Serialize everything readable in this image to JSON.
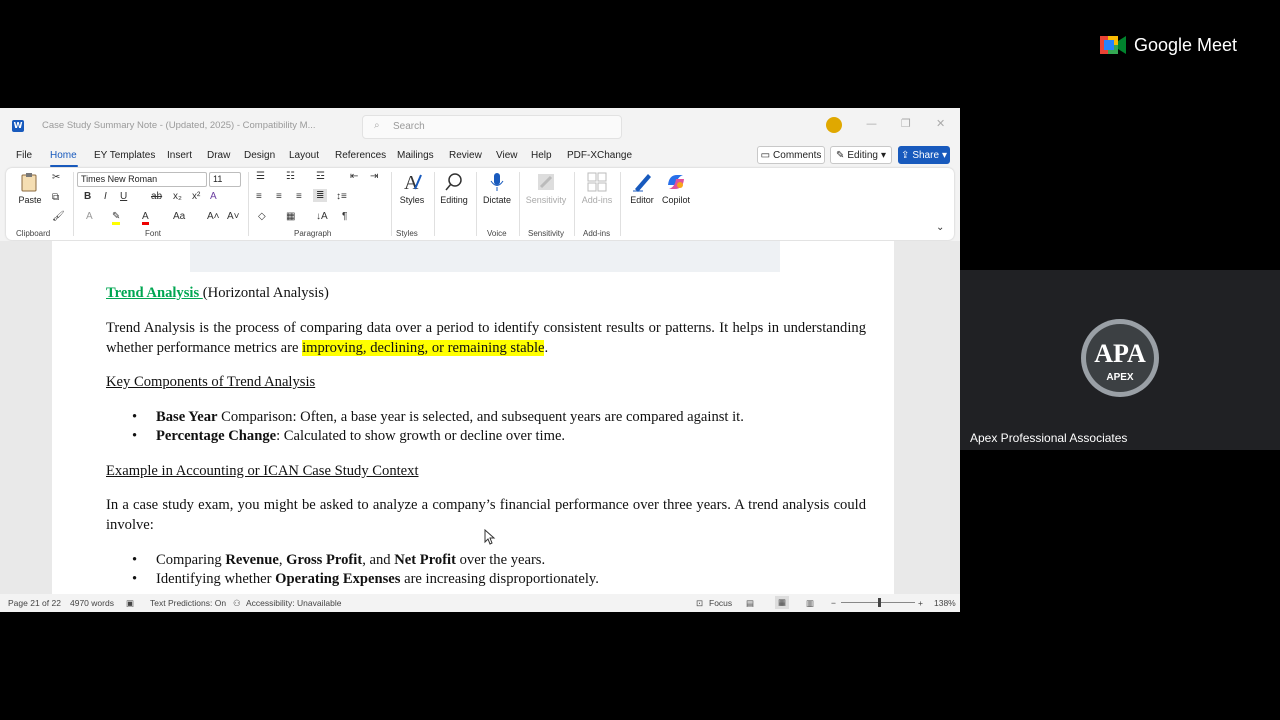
{
  "meet": {
    "logo_text": "Google Meet"
  },
  "participant": {
    "name": "Apex Professional Associates",
    "avatar_text": "APA",
    "avatar_sub": "APEX"
  },
  "word": {
    "doc_title": "Case Study Summary Note - (Updated, 2025)  -  Compatibility M...",
    "search_placeholder": "Search",
    "menu": [
      "File",
      "Home",
      "EY Templates",
      "Insert",
      "Draw",
      "Design",
      "Layout",
      "References",
      "Mailings",
      "Review",
      "View",
      "Help",
      "PDF-XChange"
    ],
    "buttons": {
      "comments": "Comments",
      "editing": "Editing",
      "share": "Share"
    },
    "ribbon": {
      "paste": "Paste",
      "font_name": "Times New Roman",
      "font_size": "11",
      "styles": "Styles",
      "editing": "Editing",
      "dictate": "Dictate",
      "sensitivity": "Sensitivity",
      "addins": "Add-ins",
      "editor": "Editor",
      "copilot": "Copilot",
      "groups": {
        "clipboard": "Clipboard",
        "font": "Font",
        "paragraph": "Paragraph",
        "styles": "Styles",
        "voice": "Voice",
        "sensitivity": "Sensitivity",
        "addins": "Add-ins"
      }
    },
    "document": {
      "heading_link": "Trend Analysis ",
      "heading_rest": "(Horizontal Analysis)",
      "para1_a": "Trend Analysis is the process of comparing data over a period to identify consistent results or patterns. It helps in understanding whether performance metrics are ",
      "para1_hl": "improving, declining, or remaining stable",
      "para1_end": ".",
      "subhead1": "Key Components of Trend Analysis",
      "b1_bold": "Base Year",
      "b1_rest": " Comparison: Often, a base year is selected, and subsequent years are compared against it.",
      "b2_bold": "Percentage Change",
      "b2_rest": ": Calculated to show growth or decline over time.",
      "subhead2": "Example in Accounting or ICAN Case Study Context",
      "para2": "In a case study exam, you might be asked to analyze a company’s financial performance over three years. A trend analysis could involve:",
      "b3_a": "Comparing ",
      "b3_b1": "Revenue",
      "b3_c": ", ",
      "b3_b2": "Gross Profit",
      "b3_d": ", and ",
      "b3_b3": "Net Profit",
      "b3_e": " over the years.",
      "b4_a": "Identifying whether ",
      "b4_b": "Operating Expenses",
      "b4_c": " are increasing disproportionately."
    },
    "status": {
      "page": "Page 21 of 22",
      "words": "4970 words",
      "predictions": "Text Predictions: On",
      "accessibility": "Accessibility: Unavailable",
      "focus": "Focus",
      "zoom": "138%"
    }
  }
}
